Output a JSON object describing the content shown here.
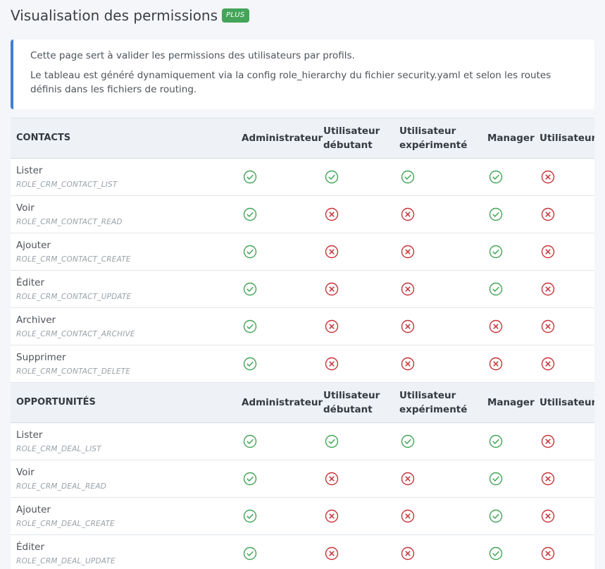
{
  "page": {
    "title": "Visualisation des permissions",
    "badge": "PLUS",
    "intro_line1": "Cette page sert à valider les permissions des utilisateurs par profils.",
    "intro_line2": "Le tableau est généré dynamiquement via la config role_hierarchy du fichier security.yaml et selon les routes définis dans les fichiers de routing."
  },
  "colors": {
    "allowed": "#44a559",
    "denied": "#c8353a",
    "callout_border": "#3f7fd6",
    "badge": "#44a559"
  },
  "profiles": [
    "Administrateur",
    "Utilisateur débutant",
    "Utilisateur expérimenté",
    "Manager",
    "Utilisateur"
  ],
  "sections": [
    {
      "name": "CONTACTS",
      "rows": [
        {
          "label": "Lister",
          "role": "ROLE_CRM_CONTACT_LIST",
          "permissions": [
            true,
            true,
            true,
            true,
            false
          ]
        },
        {
          "label": "Voir",
          "role": "ROLE_CRM_CONTACT_READ",
          "permissions": [
            true,
            false,
            false,
            true,
            false
          ]
        },
        {
          "label": "Ajouter",
          "role": "ROLE_CRM_CONTACT_CREATE",
          "permissions": [
            true,
            false,
            false,
            true,
            false
          ]
        },
        {
          "label": "Éditer",
          "role": "ROLE_CRM_CONTACT_UPDATE",
          "permissions": [
            true,
            false,
            false,
            true,
            false
          ]
        },
        {
          "label": "Archiver",
          "role": "ROLE_CRM_CONTACT_ARCHIVE",
          "permissions": [
            true,
            false,
            false,
            false,
            false
          ]
        },
        {
          "label": "Supprimer",
          "role": "ROLE_CRM_CONTACT_DELETE",
          "permissions": [
            true,
            false,
            false,
            false,
            false
          ]
        }
      ]
    },
    {
      "name": "OPPORTUNITÉS",
      "rows": [
        {
          "label": "Lister",
          "role": "ROLE_CRM_DEAL_LIST",
          "permissions": [
            true,
            true,
            true,
            true,
            false
          ]
        },
        {
          "label": "Voir",
          "role": "ROLE_CRM_DEAL_READ",
          "permissions": [
            true,
            false,
            false,
            true,
            false
          ]
        },
        {
          "label": "Ajouter",
          "role": "ROLE_CRM_DEAL_CREATE",
          "permissions": [
            true,
            false,
            false,
            true,
            false
          ]
        },
        {
          "label": "Éditer",
          "role": "ROLE_CRM_DEAL_UPDATE",
          "permissions": [
            true,
            false,
            false,
            true,
            false
          ]
        }
      ]
    }
  ]
}
